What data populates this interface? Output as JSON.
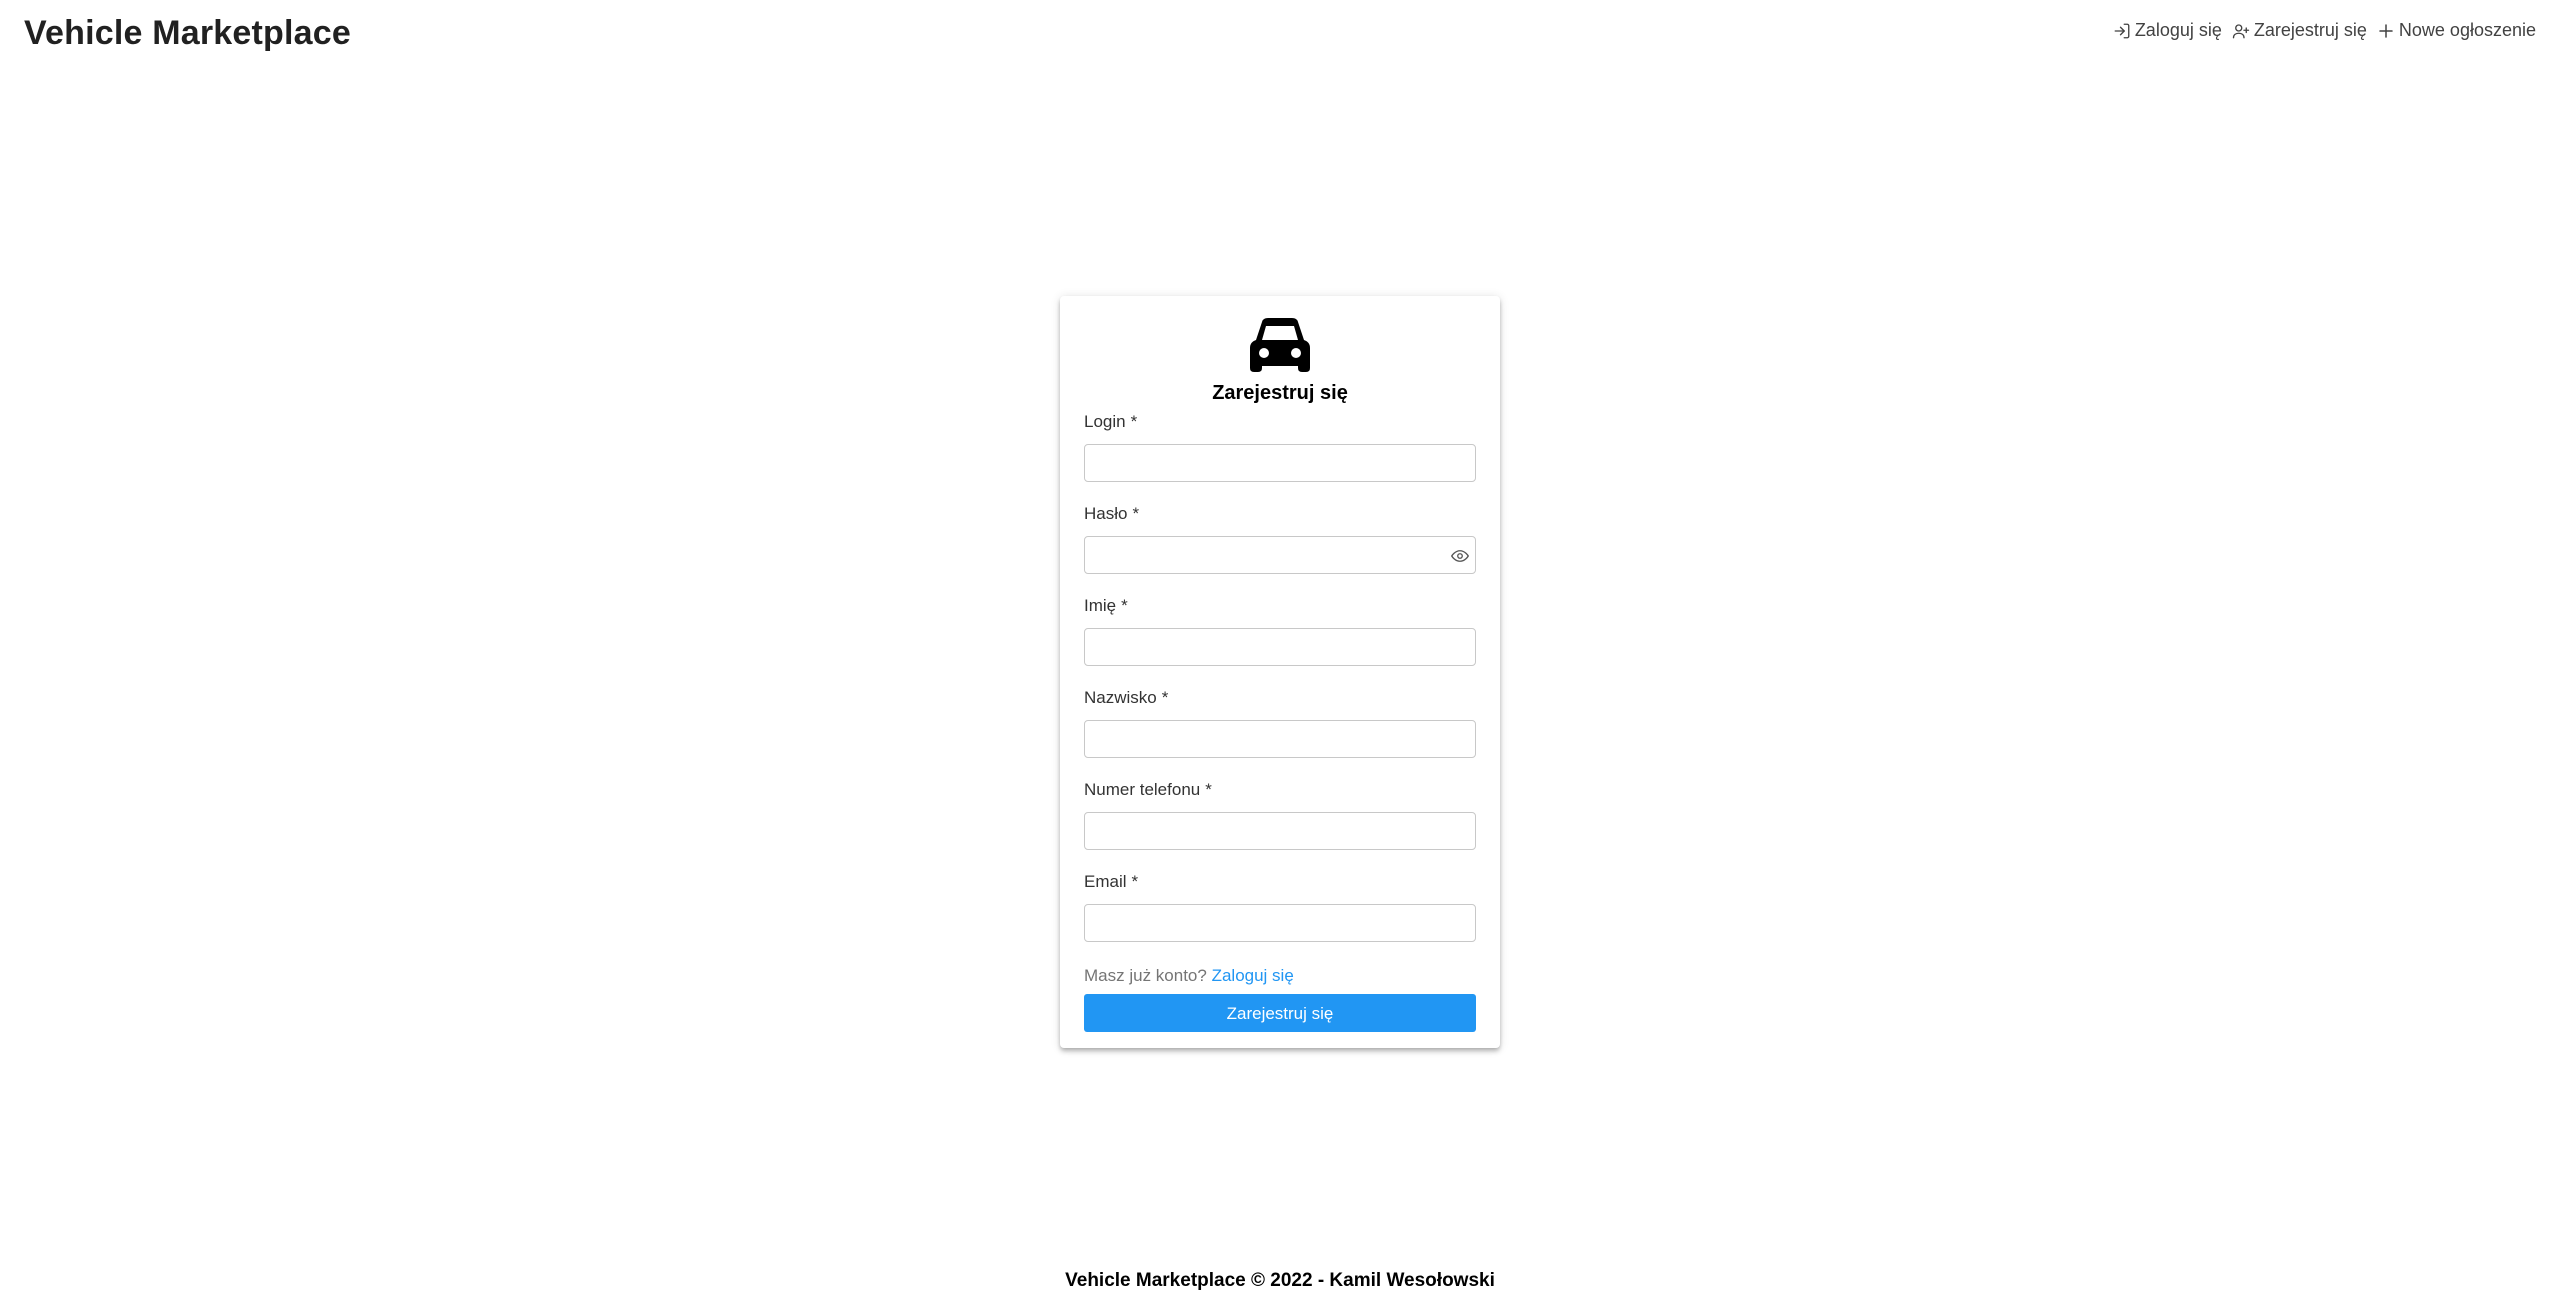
{
  "header": {
    "brand": "Vehicle Marketplace",
    "nav": [
      {
        "label": "Zaloguj się",
        "icon": "login-icon"
      },
      {
        "label": "Zarejestruj się",
        "icon": "user-plus-icon"
      },
      {
        "label": "Nowe ogłoszenie",
        "icon": "plus-icon"
      }
    ]
  },
  "form": {
    "icon": "car-icon",
    "title": "Zarejestruj się",
    "required_marker": "*",
    "fields": [
      {
        "label": "Login",
        "value": ""
      },
      {
        "label": "Hasło",
        "value": "",
        "icon": "eye-icon"
      },
      {
        "label": "Imię",
        "value": ""
      },
      {
        "label": "Nazwisko",
        "value": ""
      },
      {
        "label": "Numer telefonu",
        "value": ""
      },
      {
        "label": "Email",
        "value": ""
      }
    ],
    "already_text": "Masz już konto?",
    "login_link": "Zaloguj się",
    "submit_label": "Zarejestruj się"
  },
  "footer": {
    "text": "Vehicle Marketplace © 2022 - Kamil Wesołowski"
  },
  "colors": {
    "accent": "#2196f3",
    "text": "#212121",
    "muted": "#757575"
  }
}
